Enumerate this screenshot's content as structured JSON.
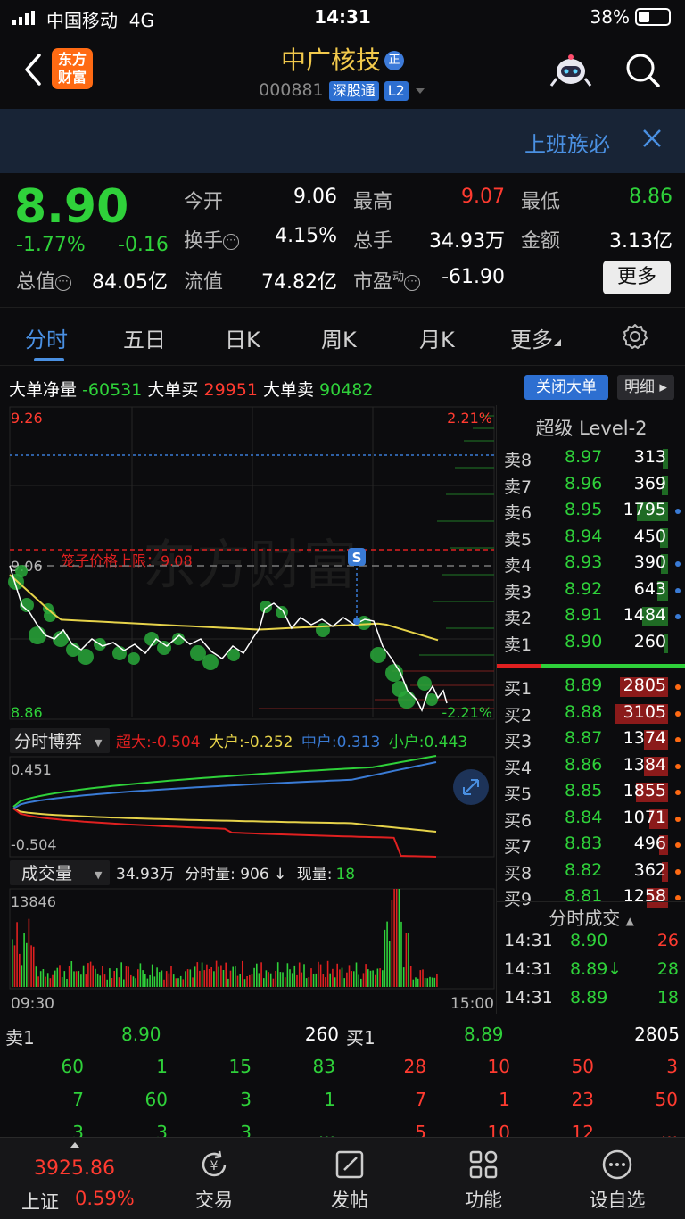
{
  "status": {
    "carrier": "中国移动",
    "network": "4G",
    "time": "14:31",
    "battery": "38%"
  },
  "header": {
    "logo_line1": "东方",
    "logo_line2": "财富",
    "title": "中广核技",
    "title_badge": "正",
    "code": "000881",
    "tag1": "深股通",
    "tag2": "L2"
  },
  "banner": {
    "text": "上班族必"
  },
  "quote": {
    "price": "8.90",
    "change_pct": "-1.77%",
    "change": "-0.16",
    "open_label": "今开",
    "open": "9.06",
    "high_label": "最高",
    "high": "9.07",
    "low_label": "最低",
    "low": "8.86",
    "turnover_label": "换手",
    "turnover": "4.15%",
    "volume_label": "总手",
    "volume": "34.93万",
    "amount_label": "金额",
    "amount": "3.13亿",
    "mktcap_label": "总值",
    "mktcap": "84.05亿",
    "float_label": "流值",
    "float": "74.82亿",
    "pe_label": "市盈",
    "pe_sup": "动",
    "pe": "-61.90",
    "more_button": "更多"
  },
  "tabs": [
    "分时",
    "五日",
    "日K",
    "周K",
    "月K",
    "更多"
  ],
  "bigorder": {
    "net_label": "大单净量",
    "net": "-60531",
    "buy_label": "大单买",
    "buy": "29951",
    "sell_label": "大单卖",
    "sell": "90482",
    "close_button": "关闭大单",
    "detail_button": "明细"
  },
  "chart": {
    "price_high": "9.26",
    "pct_high": "2.21%",
    "prev_close": "9.06",
    "price_low": "8.86",
    "pct_low": "-2.21%",
    "cage_label": "笼子价格上限：9.08",
    "watermark": "东方财富",
    "s_marker": "S",
    "game_title": "分时博弈",
    "game_super_label": "超大:",
    "game_super": "-0.504",
    "game_big_label": "大户:",
    "game_big": "-0.252",
    "game_mid_label": "中户:",
    "game_mid": "0.313",
    "game_small_label": "小户:",
    "game_small": "0.443",
    "game_top": "0.451",
    "game_bottom": "-0.504",
    "vol_title": "成交量",
    "vol_total": "34.93万",
    "vol_minute": "分时量: 906 ↓",
    "vol_now_label": "现量:",
    "vol_now": "18",
    "vol_max": "13846",
    "time_start": "09:30",
    "time_end": "15:00",
    "colors": {
      "price": "#ffffff",
      "avg": "#e6d34a",
      "super": "#e02020",
      "big": "#e6d34a",
      "mid": "#3a7bd5",
      "small": "#2fd13a"
    }
  },
  "orderbook": {
    "title": "超级 Level-2",
    "asks": [
      {
        "label": "卖8",
        "price": "8.97",
        "vol": "313",
        "dot": ""
      },
      {
        "label": "卖7",
        "price": "8.96",
        "vol": "369",
        "dot": ""
      },
      {
        "label": "卖6",
        "price": "8.95",
        "vol": "1795",
        "dot": "blue"
      },
      {
        "label": "卖5",
        "price": "8.94",
        "vol": "450",
        "dot": ""
      },
      {
        "label": "卖4",
        "price": "8.93",
        "vol": "390",
        "dot": "blue"
      },
      {
        "label": "卖3",
        "price": "8.92",
        "vol": "643",
        "dot": "blue"
      },
      {
        "label": "卖2",
        "price": "8.91",
        "vol": "1484",
        "dot": "blue"
      },
      {
        "label": "卖1",
        "price": "8.90",
        "vol": "260",
        "dot": ""
      }
    ],
    "bids": [
      {
        "label": "买1",
        "price": "8.89",
        "vol": "2805",
        "dot": "orange"
      },
      {
        "label": "买2",
        "price": "8.88",
        "vol": "3105",
        "dot": "orange"
      },
      {
        "label": "买3",
        "price": "8.87",
        "vol": "1374",
        "dot": "orange"
      },
      {
        "label": "买4",
        "price": "8.86",
        "vol": "1384",
        "dot": "orange"
      },
      {
        "label": "买5",
        "price": "8.85",
        "vol": "1855",
        "dot": "orange"
      },
      {
        "label": "买6",
        "price": "8.84",
        "vol": "1071",
        "dot": "orange"
      },
      {
        "label": "买7",
        "price": "8.83",
        "vol": "496",
        "dot": "orange"
      },
      {
        "label": "买8",
        "price": "8.82",
        "vol": "362",
        "dot": "orange"
      },
      {
        "label": "买9",
        "price": "8.81",
        "vol": "1258",
        "dot": "orange"
      }
    ]
  },
  "timesales": {
    "title": "分时成交",
    "rows": [
      {
        "time": "14:31",
        "price": "8.90",
        "vol": "26",
        "vcolor": "red"
      },
      {
        "time": "14:31",
        "price": "8.89↓",
        "vol": "28",
        "vcolor": "green"
      },
      {
        "time": "14:31",
        "price": "8.89",
        "vol": "18",
        "vcolor": "green"
      }
    ]
  },
  "levelboard": {
    "ask_label": "卖1",
    "ask_price": "8.90",
    "ask_vol": "260",
    "bid_label": "买1",
    "bid_price": "8.89",
    "bid_vol": "2805",
    "ask_rows": [
      [
        "60",
        "1",
        "15",
        "83"
      ],
      [
        "7",
        "60",
        "3",
        "1"
      ],
      [
        "3",
        "3",
        "3",
        "..."
      ]
    ],
    "bid_rows": [
      [
        "28",
        "10",
        "50",
        "3"
      ],
      [
        "7",
        "1",
        "23",
        "50"
      ],
      [
        "5",
        "10",
        "12",
        "..."
      ]
    ]
  },
  "bottomnav": {
    "index_value": "3925.86",
    "index_name": "上证",
    "index_pct": "0.59%",
    "items": [
      "交易",
      "发帖",
      "功能",
      "设自选"
    ]
  }
}
